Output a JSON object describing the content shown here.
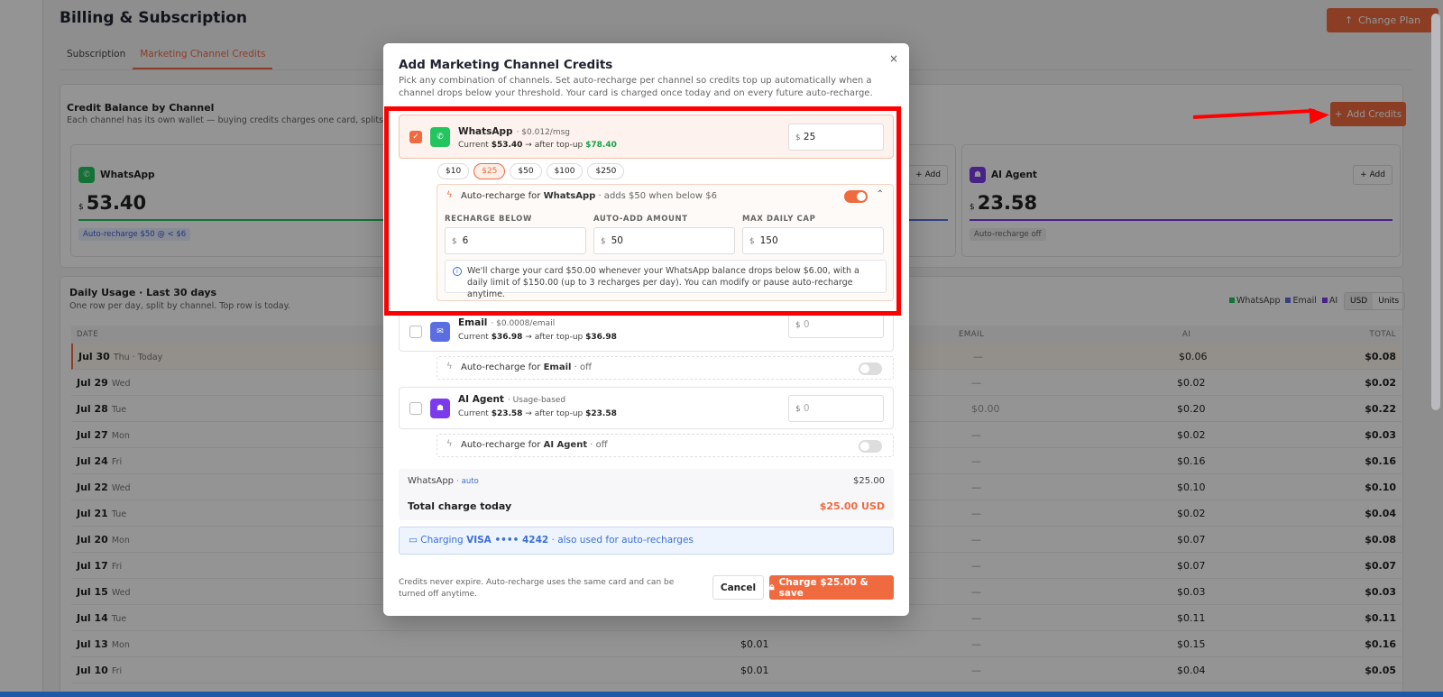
{
  "page": {
    "title": "Billing & Subscription",
    "change_plan": "Change Plan",
    "tabs": [
      "Subscription",
      "Marketing Channel Credits"
    ]
  },
  "credit_balance": {
    "title": "Credit Balance by Channel",
    "subtitle": "Each channel has its own wallet — buying credits charges one card, splits into",
    "add_credits": "Add Credits",
    "wallets": [
      {
        "name": "WhatsApp",
        "currency": "$",
        "amount": "53.40",
        "chip": "Auto-recharge $50 @ < $6",
        "color": "#22c55e"
      },
      {
        "name": "AI Agent",
        "currency": "$",
        "amount": "23.58",
        "chip": "Auto-recharge off",
        "color": "#7c3aed",
        "add": "Add"
      }
    ],
    "hidden_add": "Add"
  },
  "usage": {
    "title": "Daily Usage · Last 30 days",
    "subtitle": "One row per day, split by channel. Top row is today.",
    "legend": [
      "WhatsApp",
      "Email",
      "AI"
    ],
    "units": [
      "USD",
      "Units"
    ],
    "headers": {
      "date": "DATE",
      "email": "EMAIL",
      "ai": "AI",
      "total": "TOTAL"
    },
    "rows": [
      {
        "date": "Jul 30",
        "day": "Thu · Today",
        "wa": "",
        "email": "—",
        "ai": "$0.06",
        "total": "$0.08"
      },
      {
        "date": "Jul 29",
        "day": "Wed",
        "wa": "",
        "email": "—",
        "ai": "$0.02",
        "total": "$0.02"
      },
      {
        "date": "Jul 28",
        "day": "Tue",
        "wa": "",
        "email": "$0.00",
        "ai": "$0.20",
        "total": "$0.22"
      },
      {
        "date": "Jul 27",
        "day": "Mon",
        "wa": "",
        "email": "—",
        "ai": "$0.02",
        "total": "$0.03"
      },
      {
        "date": "Jul 24",
        "day": "Fri",
        "wa": "",
        "email": "—",
        "ai": "$0.16",
        "total": "$0.16"
      },
      {
        "date": "Jul 22",
        "day": "Wed",
        "wa": "",
        "email": "—",
        "ai": "$0.10",
        "total": "$0.10"
      },
      {
        "date": "Jul 21",
        "day": "Tue",
        "wa": "",
        "email": "—",
        "ai": "$0.02",
        "total": "$0.04"
      },
      {
        "date": "Jul 20",
        "day": "Mon",
        "wa": "",
        "email": "—",
        "ai": "$0.07",
        "total": "$0.08"
      },
      {
        "date": "Jul 17",
        "day": "Fri",
        "wa": "",
        "email": "—",
        "ai": "$0.07",
        "total": "$0.07"
      },
      {
        "date": "Jul 15",
        "day": "Wed",
        "wa": "",
        "email": "—",
        "ai": "$0.03",
        "total": "$0.03"
      },
      {
        "date": "Jul 14",
        "day": "Tue",
        "wa": "",
        "email": "—",
        "ai": "$0.11",
        "total": "$0.11"
      },
      {
        "date": "Jul 13",
        "day": "Mon",
        "wa": "$0.01",
        "email": "—",
        "ai": "$0.15",
        "total": "$0.16"
      },
      {
        "date": "Jul 10",
        "day": "Fri",
        "wa": "$0.01",
        "email": "—",
        "ai": "$0.04",
        "total": "$0.05"
      }
    ]
  },
  "modal": {
    "title": "Add Marketing Channel Credits",
    "close": "×",
    "description": "Pick any combination of channels. Set auto-recharge per channel so credits top up automatically when a channel drops below your threshold. Your card is charged once today and on every future auto-recharge.",
    "channels": [
      {
        "name": "WhatsApp",
        "rate": "· $0.012/msg",
        "current_prefix": "Current",
        "current": "$53.40",
        "arrow": "→ after top-up",
        "after": "$78.40",
        "currency": "$",
        "value": "25",
        "chips": [
          "$10",
          "$25",
          "$50",
          "$100",
          "$250"
        ],
        "ar_prefix": "Auto-recharge for",
        "ar_channel": "WhatsApp",
        "ar_suffix": "· adds $50 when below $6",
        "fields": [
          {
            "label": "RECHARGE BELOW",
            "value": "6"
          },
          {
            "label": "AUTO-ADD AMOUNT",
            "value": "50"
          },
          {
            "label": "MAX DAILY CAP",
            "value": "150"
          }
        ],
        "info": "We'll charge your card $50.00 whenever your WhatsApp balance drops below $6.00, with a daily limit of $150.00 (up to 3 recharges per day). You can modify or pause auto-recharge anytime."
      },
      {
        "name": "Email",
        "rate": "· $0.0008/email",
        "current_prefix": "Current",
        "current": "$36.98",
        "arrow": "→ after top-up",
        "after": "$36.98",
        "currency": "$",
        "placeholder": "0",
        "ar_prefix": "Auto-recharge for",
        "ar_channel": "Email",
        "ar_suffix": "· off"
      },
      {
        "name": "AI Agent",
        "rate": "· Usage-based",
        "current_prefix": "Current",
        "current": "$23.58",
        "arrow": "→ after top-up",
        "after": "$23.58",
        "currency": "$",
        "placeholder": "0",
        "ar_prefix": "Auto-recharge for",
        "ar_channel": "AI Agent",
        "ar_suffix": "· off"
      }
    ],
    "summary": {
      "line_label": "WhatsApp",
      "line_tag": "· auto",
      "line_amount": "$25.00",
      "total_label": "Total charge today",
      "total_amount": "$25.00 USD"
    },
    "payment": {
      "prefix": "Charging",
      "card": "VISA •••• 4242",
      "suffix": "· also used for auto-recharges"
    },
    "footer_note": "Credits never expire. Auto-recharge uses the same card and can be turned off anytime.",
    "cancel": "Cancel",
    "charge": "Charge $25.00 & save"
  },
  "colors": {
    "accent": "#ef6b3f",
    "whatsapp": "#22c55e",
    "email": "#5b6ee1",
    "ai": "#7c3aed",
    "annotation": "#ff0000"
  }
}
